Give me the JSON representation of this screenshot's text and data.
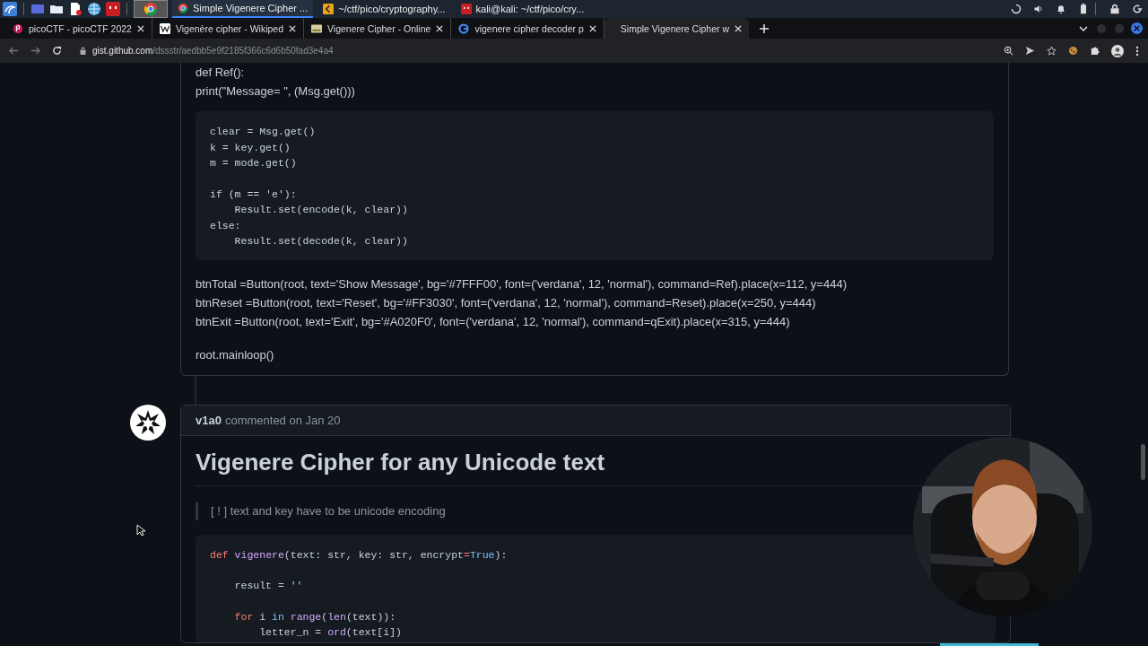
{
  "taskbar": {
    "apps": [
      {
        "label": "Simple Vigenere Cipher ...",
        "kind": "browser",
        "selected": true
      },
      {
        "label": "~/ctf/pico/cryptography...",
        "kind": "editor",
        "selected": false
      },
      {
        "label": "kali@kali: ~/ctf/pico/cry...",
        "kind": "terminal",
        "selected": false
      }
    ]
  },
  "tabs": [
    {
      "label": "picoCTF - picoCTF 2022",
      "kind": "flag",
      "selected": false
    },
    {
      "label": "Vigenère cipher - Wikiped",
      "kind": "wiki",
      "selected": false
    },
    {
      "label": "Vigenere Cipher - Online",
      "kind": "page",
      "selected": false
    },
    {
      "label": "vigenere cipher decoder p",
      "kind": "search",
      "selected": false
    },
    {
      "label": "Simple Vigenere Cipher w",
      "kind": "none",
      "selected": true
    }
  ],
  "address_bar": {
    "host": "gist.github.com",
    "path": "/dssstr/aedbb5e9f2185f366c6d6b50fad3e4a4"
  },
  "comment_1": {
    "lines_before": [
      "def Ref():",
      "print(\"Message= \", (Msg.get()))"
    ],
    "code_groups": [
      [
        "clear = Msg.get()",
        "k = key.get()",
        "m = mode.get()"
      ],
      [
        "if (m == 'e'):",
        "    Result.set(encode(k, clear))",
        "else:",
        "    Result.set(decode(k, clear))"
      ]
    ],
    "paragraphs": [
      [
        "btnTotal =Button(root, text='Show Message', bg='#7FFF00', font=('verdana', 12, 'normal'), command=Ref).place(x=112, y=444)",
        "btnReset =Button(root, text='Reset', bg='#FF3030', font=('verdana', 12, 'normal'), command=Reset).place(x=250, y=444)",
        "btnExit =Button(root, text='Exit', bg='#A020F0', font=('verdana', 12, 'normal'), command=qExit).place(x=315, y=444)"
      ],
      [
        "root.mainloop()"
      ]
    ]
  },
  "comment_2": {
    "author": "v1a0",
    "meta": "commented on Jan 20",
    "heading": "Vigenere Cipher for any Unicode text",
    "quote": "[ ! ] text and key have to be unicode encoding",
    "code_groups": [
      [
        [
          {
            "kind": "keyword",
            "text": "def"
          },
          {
            "kind": "function",
            "text": " vigenere"
          },
          {
            "kind": "plain",
            "text": "(text: str, key: str, encrypt"
          },
          {
            "kind": "keyword",
            "text": "="
          },
          {
            "kind": "constant",
            "text": "True"
          },
          {
            "kind": "plain",
            "text": "):"
          }
        ]
      ],
      [
        [
          {
            "kind": "plain",
            "text": "    result = "
          },
          {
            "kind": "string",
            "text": "''"
          }
        ]
      ],
      [
        [
          {
            "kind": "keyword",
            "text": "    for"
          },
          {
            "kind": "plain",
            "text": " i "
          },
          {
            "kind": "constant",
            "text": "in"
          },
          {
            "kind": "function",
            "text": " range"
          },
          {
            "kind": "plain",
            "text": "("
          },
          {
            "kind": "function",
            "text": "len"
          },
          {
            "kind": "plain",
            "text": "(text)):"
          }
        ],
        [
          {
            "kind": "plain",
            "text": "        letter_n = "
          },
          {
            "kind": "function",
            "text": "ord"
          },
          {
            "kind": "plain",
            "text": "(text[i])"
          }
        ]
      ]
    ]
  }
}
